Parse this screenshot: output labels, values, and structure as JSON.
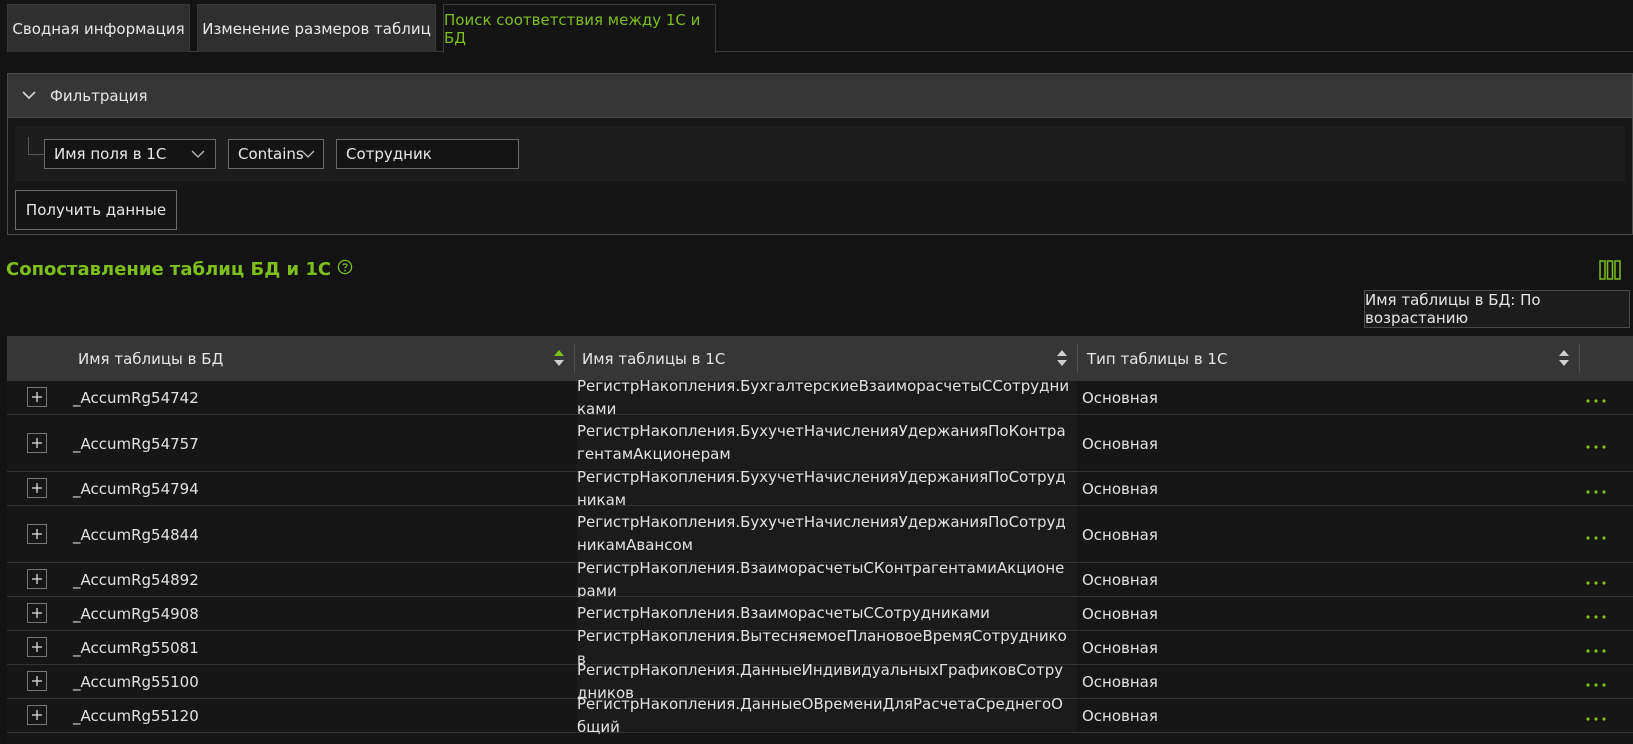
{
  "tabs": [
    {
      "label": "Сводная информация"
    },
    {
      "label": "Изменение размеров таблиц"
    },
    {
      "label": "Поиск соответствия между 1С и БД"
    }
  ],
  "filter": {
    "title": "Фильтрация",
    "field_select": "Имя поля в 1С",
    "operator_select": "Contains",
    "value": "Сотрудник",
    "submit_label": "Получить данные"
  },
  "section": {
    "title": "Сопоставление таблиц БД и 1С",
    "sort_badge": "Имя таблицы в БД: По возрастанию"
  },
  "table": {
    "headers": [
      "Имя таблицы в БД",
      "Имя таблицы в 1С",
      "Тип таблицы в 1С"
    ],
    "rows": [
      {
        "db": "_AccumRg54742",
        "name1c": "РегистрНакопления.БухгалтерскиеВзаиморасчетыССотрудниками",
        "type": "Основная"
      },
      {
        "db": "_AccumRg54757",
        "name1c": "РегистрНакопления.БухучетНачисленияУдержанияПоКонтрагентамАкционерам",
        "type": "Основная"
      },
      {
        "db": "_AccumRg54794",
        "name1c": "РегистрНакопления.БухучетНачисленияУдержанияПоСотрудникам",
        "type": "Основная"
      },
      {
        "db": "_AccumRg54844",
        "name1c": "РегистрНакопления.БухучетНачисленияУдержанияПоСотрудникамАвансом",
        "type": "Основная"
      },
      {
        "db": "_AccumRg54892",
        "name1c": "РегистрНакопления.ВзаиморасчетыСКонтрагентамиАкционерами",
        "type": "Основная"
      },
      {
        "db": "_AccumRg54908",
        "name1c": "РегистрНакопления.ВзаиморасчетыССотрудниками",
        "type": "Основная"
      },
      {
        "db": "_AccumRg55081",
        "name1c": "РегистрНакопления.ВытесняемоеПлановоеВремяСотрудников",
        "type": "Основная"
      },
      {
        "db": "_AccumRg55100",
        "name1c": "РегистрНакопления.ДанныеИндивидуальныхГрафиковСотрудников",
        "type": "Основная"
      },
      {
        "db": "_AccumRg55120",
        "name1c": "РегистрНакопления.ДанныеОВремениДляРасчетаСреднегоОбщий",
        "type": "Основная"
      }
    ]
  },
  "colors": {
    "accent": "#7ebf1c"
  }
}
